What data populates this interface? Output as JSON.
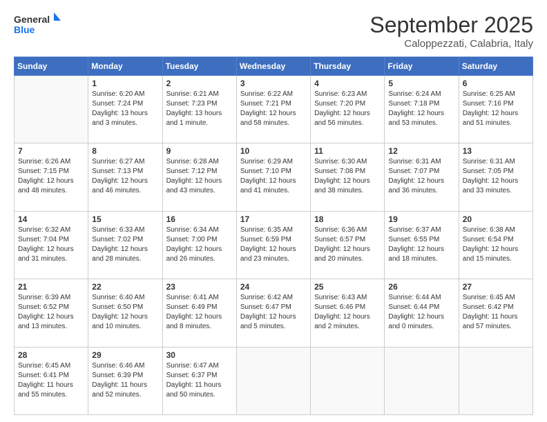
{
  "logo": {
    "general": "General",
    "blue": "Blue"
  },
  "header": {
    "month": "September 2025",
    "location": "Caloppezzati, Calabria, Italy"
  },
  "weekdays": [
    "Sunday",
    "Monday",
    "Tuesday",
    "Wednesday",
    "Thursday",
    "Friday",
    "Saturday"
  ],
  "weeks": [
    [
      {
        "day": "",
        "info": ""
      },
      {
        "day": "1",
        "info": "Sunrise: 6:20 AM\nSunset: 7:24 PM\nDaylight: 13 hours\nand 3 minutes."
      },
      {
        "day": "2",
        "info": "Sunrise: 6:21 AM\nSunset: 7:23 PM\nDaylight: 13 hours\nand 1 minute."
      },
      {
        "day": "3",
        "info": "Sunrise: 6:22 AM\nSunset: 7:21 PM\nDaylight: 12 hours\nand 58 minutes."
      },
      {
        "day": "4",
        "info": "Sunrise: 6:23 AM\nSunset: 7:20 PM\nDaylight: 12 hours\nand 56 minutes."
      },
      {
        "day": "5",
        "info": "Sunrise: 6:24 AM\nSunset: 7:18 PM\nDaylight: 12 hours\nand 53 minutes."
      },
      {
        "day": "6",
        "info": "Sunrise: 6:25 AM\nSunset: 7:16 PM\nDaylight: 12 hours\nand 51 minutes."
      }
    ],
    [
      {
        "day": "7",
        "info": "Sunrise: 6:26 AM\nSunset: 7:15 PM\nDaylight: 12 hours\nand 48 minutes."
      },
      {
        "day": "8",
        "info": "Sunrise: 6:27 AM\nSunset: 7:13 PM\nDaylight: 12 hours\nand 46 minutes."
      },
      {
        "day": "9",
        "info": "Sunrise: 6:28 AM\nSunset: 7:12 PM\nDaylight: 12 hours\nand 43 minutes."
      },
      {
        "day": "10",
        "info": "Sunrise: 6:29 AM\nSunset: 7:10 PM\nDaylight: 12 hours\nand 41 minutes."
      },
      {
        "day": "11",
        "info": "Sunrise: 6:30 AM\nSunset: 7:08 PM\nDaylight: 12 hours\nand 38 minutes."
      },
      {
        "day": "12",
        "info": "Sunrise: 6:31 AM\nSunset: 7:07 PM\nDaylight: 12 hours\nand 36 minutes."
      },
      {
        "day": "13",
        "info": "Sunrise: 6:31 AM\nSunset: 7:05 PM\nDaylight: 12 hours\nand 33 minutes."
      }
    ],
    [
      {
        "day": "14",
        "info": "Sunrise: 6:32 AM\nSunset: 7:04 PM\nDaylight: 12 hours\nand 31 minutes."
      },
      {
        "day": "15",
        "info": "Sunrise: 6:33 AM\nSunset: 7:02 PM\nDaylight: 12 hours\nand 28 minutes."
      },
      {
        "day": "16",
        "info": "Sunrise: 6:34 AM\nSunset: 7:00 PM\nDaylight: 12 hours\nand 26 minutes."
      },
      {
        "day": "17",
        "info": "Sunrise: 6:35 AM\nSunset: 6:59 PM\nDaylight: 12 hours\nand 23 minutes."
      },
      {
        "day": "18",
        "info": "Sunrise: 6:36 AM\nSunset: 6:57 PM\nDaylight: 12 hours\nand 20 minutes."
      },
      {
        "day": "19",
        "info": "Sunrise: 6:37 AM\nSunset: 6:55 PM\nDaylight: 12 hours\nand 18 minutes."
      },
      {
        "day": "20",
        "info": "Sunrise: 6:38 AM\nSunset: 6:54 PM\nDaylight: 12 hours\nand 15 minutes."
      }
    ],
    [
      {
        "day": "21",
        "info": "Sunrise: 6:39 AM\nSunset: 6:52 PM\nDaylight: 12 hours\nand 13 minutes."
      },
      {
        "day": "22",
        "info": "Sunrise: 6:40 AM\nSunset: 6:50 PM\nDaylight: 12 hours\nand 10 minutes."
      },
      {
        "day": "23",
        "info": "Sunrise: 6:41 AM\nSunset: 6:49 PM\nDaylight: 12 hours\nand 8 minutes."
      },
      {
        "day": "24",
        "info": "Sunrise: 6:42 AM\nSunset: 6:47 PM\nDaylight: 12 hours\nand 5 minutes."
      },
      {
        "day": "25",
        "info": "Sunrise: 6:43 AM\nSunset: 6:46 PM\nDaylight: 12 hours\nand 2 minutes."
      },
      {
        "day": "26",
        "info": "Sunrise: 6:44 AM\nSunset: 6:44 PM\nDaylight: 12 hours\nand 0 minutes."
      },
      {
        "day": "27",
        "info": "Sunrise: 6:45 AM\nSunset: 6:42 PM\nDaylight: 11 hours\nand 57 minutes."
      }
    ],
    [
      {
        "day": "28",
        "info": "Sunrise: 6:45 AM\nSunset: 6:41 PM\nDaylight: 11 hours\nand 55 minutes."
      },
      {
        "day": "29",
        "info": "Sunrise: 6:46 AM\nSunset: 6:39 PM\nDaylight: 11 hours\nand 52 minutes."
      },
      {
        "day": "30",
        "info": "Sunrise: 6:47 AM\nSunset: 6:37 PM\nDaylight: 11 hours\nand 50 minutes."
      },
      {
        "day": "",
        "info": ""
      },
      {
        "day": "",
        "info": ""
      },
      {
        "day": "",
        "info": ""
      },
      {
        "day": "",
        "info": ""
      }
    ]
  ]
}
